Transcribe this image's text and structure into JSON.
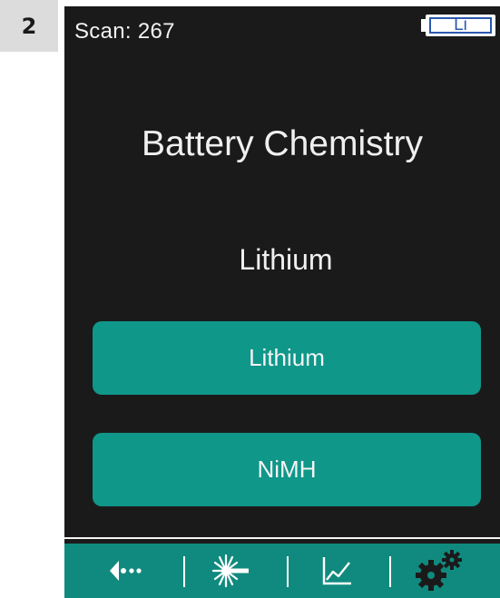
{
  "step": {
    "number": "2"
  },
  "status_bar": {
    "scan_label": "Scan: 267",
    "battery_label": "Li"
  },
  "screen": {
    "title": "Battery Chemistry",
    "current_value": "Lithium"
  },
  "options": [
    {
      "label": "Lithium"
    },
    {
      "label": "NiMH"
    }
  ],
  "toolbar": {
    "items": [
      {
        "icon": "back-menu-icon"
      },
      {
        "icon": "laser-scan-icon"
      },
      {
        "icon": "chart-icon"
      },
      {
        "icon": "settings-gears-icon"
      }
    ]
  },
  "colors": {
    "screen_background": "#1b1a1a",
    "button_teal": "#0f978a",
    "toolbar_teal": "#108a7e",
    "battery_blue": "#2a58b0"
  }
}
